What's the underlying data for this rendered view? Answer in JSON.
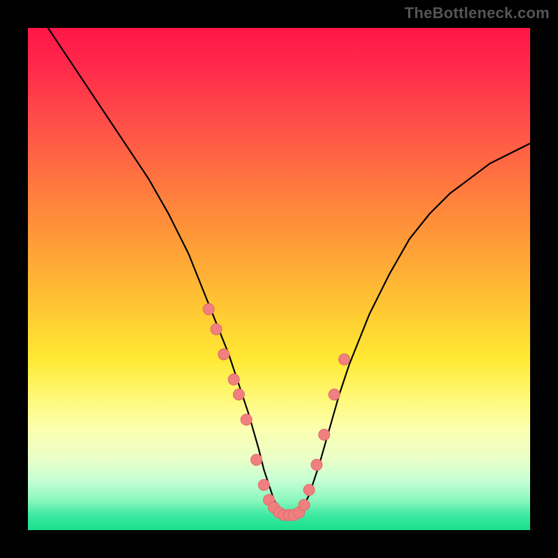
{
  "watermark": "TheBottleneck.com",
  "colors": {
    "frame": "#000000",
    "curve": "#000000",
    "marker_fill": "#f08080",
    "marker_stroke": "#e06868",
    "gradient_stops": [
      "#ff1648",
      "#ff4c4a",
      "#ff7a3e",
      "#ffc833",
      "#fff97a",
      "#e9ffc8",
      "#3ee9a2",
      "#18df8b"
    ]
  },
  "chart_data": {
    "type": "line",
    "title": "",
    "xlabel": "",
    "ylabel": "",
    "xlim": [
      0,
      100
    ],
    "ylim": [
      0,
      100
    ],
    "series": [
      {
        "name": "curve",
        "x": [
          4,
          8,
          12,
          16,
          20,
          24,
          28,
          32,
          34,
          36,
          38,
          40,
          42,
          44,
          46,
          47,
          48,
          49,
          50,
          51,
          52,
          54,
          56,
          58,
          60,
          62,
          64,
          68,
          72,
          76,
          80,
          84,
          88,
          92,
          96,
          100
        ],
        "y": [
          100,
          94,
          88,
          82,
          76,
          70,
          63,
          55,
          50,
          45,
          40,
          35,
          29,
          23,
          16,
          12,
          9,
          6,
          4,
          3,
          3,
          3,
          7,
          13,
          20,
          27,
          33,
          43,
          51,
          58,
          63,
          67,
          70,
          73,
          75,
          77
        ]
      }
    ],
    "markers": {
      "name": "highlighted-points",
      "x": [
        36,
        37.5,
        39,
        41,
        42,
        43.5,
        45.5,
        47,
        48,
        49,
        50,
        51,
        52,
        53,
        54,
        55,
        56,
        57.5,
        59,
        61,
        63
      ],
      "y": [
        44,
        40,
        35,
        30,
        27,
        22,
        14,
        9,
        6,
        4.5,
        3.5,
        3,
        3,
        3,
        3.5,
        5,
        8,
        13,
        19,
        27,
        34
      ]
    }
  }
}
